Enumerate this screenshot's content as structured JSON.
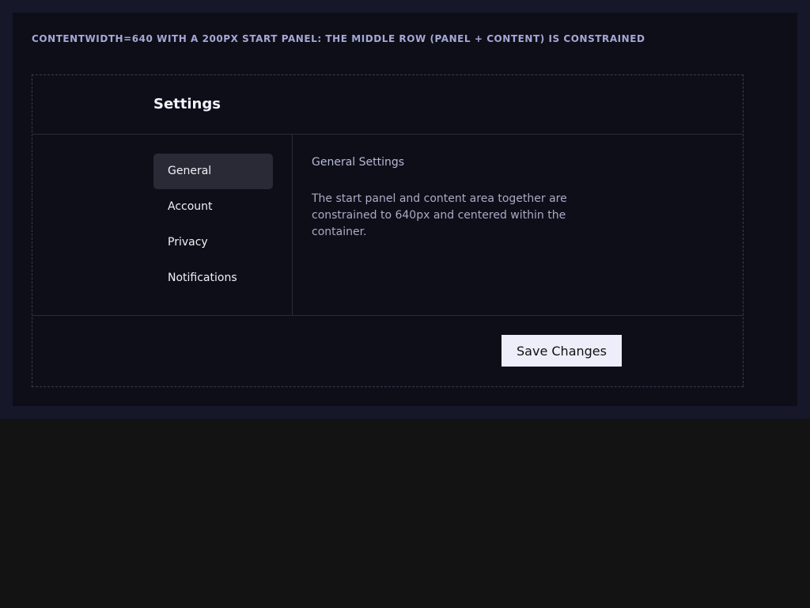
{
  "caption": "CONTENTWIDTH=640 WITH A 200PX START PANEL: THE MIDDLE ROW (PANEL + CONTENT) IS CONSTRAINED",
  "header": {
    "title": "Settings"
  },
  "sidebar": {
    "items": [
      {
        "label": "General",
        "active": true
      },
      {
        "label": "Account",
        "active": false
      },
      {
        "label": "Privacy",
        "active": false
      },
      {
        "label": "Notifications",
        "active": false
      }
    ]
  },
  "content": {
    "heading": "General Settings",
    "body": "The start panel and content area together are constrained to 640px and centered within the container."
  },
  "footer": {
    "save_label": "Save Changes"
  },
  "colors": {
    "page_background": "#131313",
    "frame_background": "#161729",
    "card_background": "#0e0e18",
    "caption_text": "#a5a8d6",
    "active_item_background": "#2a2a37",
    "button_background": "#eeeefb"
  }
}
